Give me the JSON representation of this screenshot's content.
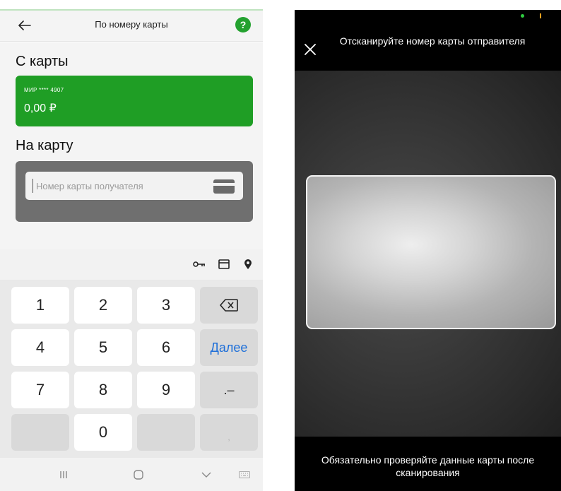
{
  "left_screen": {
    "header": {
      "title": "По номеру карты",
      "back_icon": "arrow-left-icon",
      "help_label": "?",
      "accent_color": "#23a12f"
    },
    "from_section": {
      "title": "С карты",
      "card_name": "МИР **** 4907",
      "balance": "0,00 ₽",
      "card_color": "#1f9e25"
    },
    "to_section": {
      "title": "На карту",
      "input_value": "",
      "input_placeholder": "Номер карты получателя",
      "scan_icon": "credit-card-icon"
    },
    "keyboard_toolbar": {
      "icons": [
        "key-icon",
        "card-icon",
        "location-pin-icon"
      ]
    },
    "keyboard": {
      "keys": [
        "1",
        "2",
        "3",
        "⌫",
        "4",
        "5",
        "6",
        "Далее",
        "7",
        "8",
        "9",
        ".–",
        "",
        "0",
        "",
        ","
      ],
      "action_color": "#1e6fd9"
    },
    "navbar": {
      "icons": [
        "recent-apps-icon",
        "home-icon",
        "back-chevron-icon",
        "keyboard-icon"
      ]
    }
  },
  "right_screen": {
    "header": {
      "close_icon": "close-icon",
      "title": "Отсканируйте номер карты отправителя"
    },
    "footer": {
      "hint": "Обязательно проверяйте данные карты после сканирования"
    }
  }
}
